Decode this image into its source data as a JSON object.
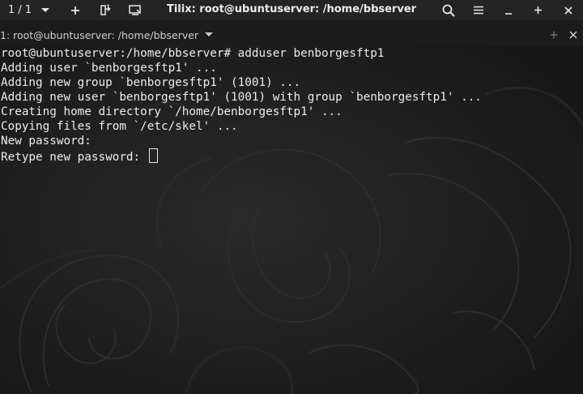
{
  "titlebar": {
    "session_count": "1 / 1",
    "title": "Tilix: root@ubuntuserver: /home/bbserver",
    "icons": [
      "chevron-down-icon",
      "plus-icon",
      "detach-icon",
      "sidebar-icon",
      "search-icon",
      "hamburger-menu-icon",
      "minimize-icon",
      "maximize-icon",
      "close-icon"
    ]
  },
  "terminal_header": {
    "title": "1: root@ubuntuserver: /home/bbserver",
    "icons": [
      "chevron-down-icon",
      "add-terminal-icon",
      "close-icon"
    ]
  },
  "terminal": {
    "lines": [
      "root@ubuntuserver:/home/bbserver# adduser benborgesftp1",
      "Adding user `benborgesftp1' ...",
      "Adding new group `benborgesftp1' (1001) ...",
      "Adding new user `benborgesftp1' (1001) with group `benborgesftp1' ...",
      "Creating home directory `/home/benborgesftp1' ...",
      "Copying files from `/etc/skel' ...",
      "New password:",
      "Retype new password: "
    ]
  },
  "colors": {
    "titlebar_bg": "#242424",
    "terminal_bg": "#1c1c1c",
    "text": "#ececec"
  }
}
